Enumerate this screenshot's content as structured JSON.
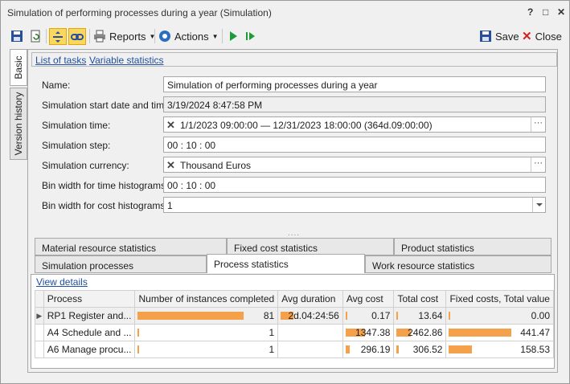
{
  "window": {
    "title": "Simulation of performing processes during a year (Simulation)",
    "help": "?",
    "restore": "□",
    "close": "✕"
  },
  "toolbar": {
    "reports_label": "Reports",
    "actions_label": "Actions",
    "save_label": "Save",
    "close_label": "Close"
  },
  "vtabs": [
    {
      "label": "Basic"
    },
    {
      "label": "Version history"
    }
  ],
  "links": {
    "list_of_tasks": "List of tasks",
    "variable_statistics": "Variable statistics"
  },
  "form": {
    "name": {
      "label": "Name:",
      "value": "Simulation of performing processes during a year"
    },
    "start": {
      "label": "Simulation start date and time:",
      "value": "3/19/2024 8:47:58 PM"
    },
    "time": {
      "label": "Simulation time:",
      "value": "1/1/2023 09:00:00 — 12/31/2023 18:00:00 (364d.09:00:00)"
    },
    "step": {
      "label": "Simulation step:",
      "value": "00 : 10 : 00"
    },
    "currency": {
      "label": "Simulation currency:",
      "value": "Thousand Euros"
    },
    "bin_time": {
      "label": "Bin width for time histograms:",
      "value": "00 : 10 : 00"
    },
    "bin_cost": {
      "label": "Bin width for cost histograms:",
      "value": "1"
    }
  },
  "tabs_row1": [
    "Material resource statistics",
    "Fixed cost statistics",
    "Product statistics"
  ],
  "tabs_row2": [
    "Simulation processes",
    "Process statistics",
    "Work resource statistics"
  ],
  "view_details": "View details",
  "table": {
    "headers": [
      "Process",
      "Number of instances completed",
      "Avg duration",
      "Avg cost",
      "Total cost",
      "Fixed costs, Total value"
    ],
    "rows": [
      {
        "process": "RP1 Register and...",
        "instances": "81",
        "instances_frac": 1.0,
        "avg_duration": "2d.04:24:56",
        "duration_frac": 1.0,
        "avg_cost": "0.17",
        "cost_frac": 0.0,
        "total_cost": "13.64",
        "total_frac": 0.0,
        "fixed": "0.00",
        "fixed_frac": 0.0
      },
      {
        "process": "A4 Schedule and ...",
        "instances": "1",
        "instances_frac": 0.012,
        "avg_duration": "",
        "duration_frac": 0,
        "avg_cost": "1347.38",
        "cost_frac": 1.0,
        "total_cost": "2462.86",
        "total_frac": 1.0,
        "fixed": "441.47",
        "fixed_frac": 1.0
      },
      {
        "process": "A6 Manage procu...",
        "instances": "1",
        "instances_frac": 0.012,
        "avg_duration": "",
        "duration_frac": 0,
        "avg_cost": "296.19",
        "cost_frac": 0.22,
        "total_cost": "306.52",
        "total_frac": 0.12,
        "fixed": "158.53",
        "fixed_frac": 0.36
      }
    ]
  },
  "colors": {
    "bar": "#f5a04a",
    "link": "#1e4fa0"
  }
}
